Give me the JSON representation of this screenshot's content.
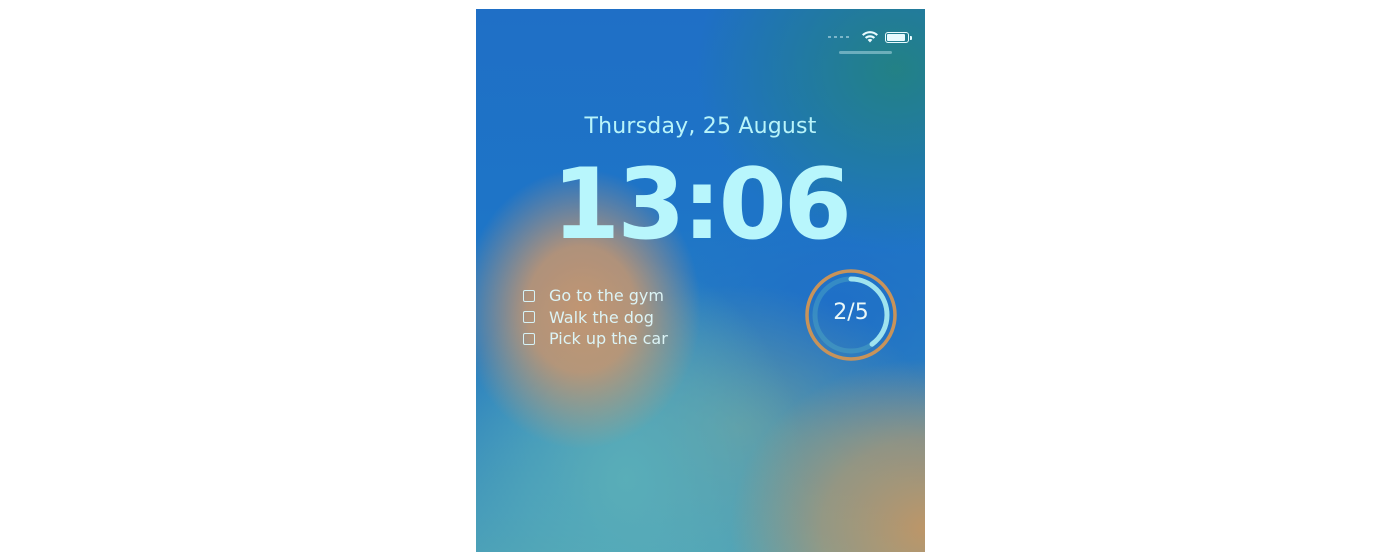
{
  "status_bar": {
    "wifi_icon": "wifi-icon",
    "battery_icon": "battery-icon",
    "battery_level": 0.9
  },
  "lock_screen": {
    "date": "Thursday, 25 August",
    "time": "13:06"
  },
  "reminders_widget": {
    "items": [
      {
        "label": "Go to the gym",
        "checked": false
      },
      {
        "label": "Walk the dog",
        "checked": false
      },
      {
        "label": "Pick up the car",
        "checked": false
      }
    ]
  },
  "progress_widget": {
    "text": "2/5",
    "completed": 2,
    "total": 5,
    "ring_color": "#c8935a",
    "progress_color": "#9fe3ef"
  }
}
